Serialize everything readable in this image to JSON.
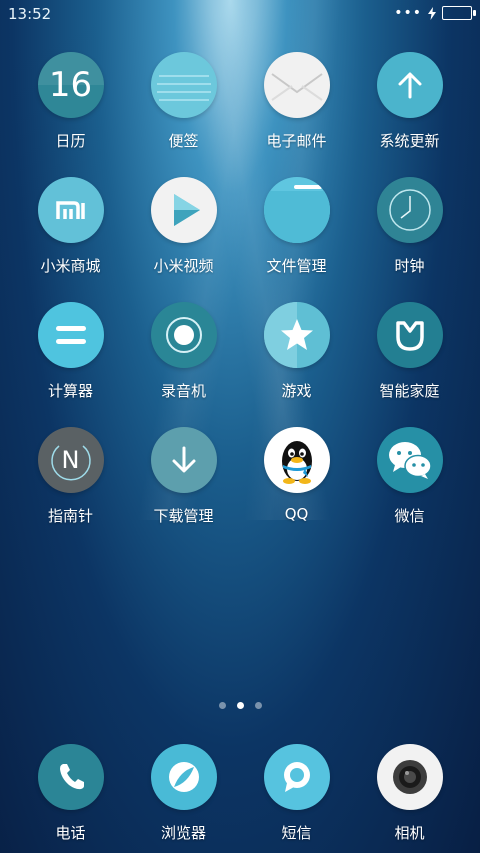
{
  "status": {
    "time": "13:52"
  },
  "colors": {
    "teal_dark": "#2e8796",
    "teal_light": "#62c4d6",
    "cyan": "#4cc0dc",
    "gray_dark": "#5c6467",
    "white": "#f2f2f2"
  },
  "apps": [
    {
      "label": "日历",
      "icon": "calendar-icon",
      "icon_text": "16"
    },
    {
      "label": "便签",
      "icon": "notes-icon"
    },
    {
      "label": "电子邮件",
      "icon": "mail-icon"
    },
    {
      "label": "系统更新",
      "icon": "update-arrow-icon"
    },
    {
      "label": "小米商城",
      "icon": "mi-store-icon",
      "icon_text": "mi"
    },
    {
      "label": "小米视频",
      "icon": "video-play-icon"
    },
    {
      "label": "文件管理",
      "icon": "folder-icon"
    },
    {
      "label": "时钟",
      "icon": "clock-icon"
    },
    {
      "label": "计算器",
      "icon": "calculator-icon"
    },
    {
      "label": "录音机",
      "icon": "recorder-icon"
    },
    {
      "label": "游戏",
      "icon": "game-star-icon"
    },
    {
      "label": "智能家庭",
      "icon": "smart-home-icon"
    },
    {
      "label": "指南针",
      "icon": "compass-icon",
      "icon_text": "N"
    },
    {
      "label": "下载管理",
      "icon": "download-icon"
    },
    {
      "label": "QQ",
      "icon": "qq-penguin-icon"
    },
    {
      "label": "微信",
      "icon": "wechat-icon"
    }
  ],
  "page_indicator": {
    "count": 3,
    "active": 2
  },
  "dock": [
    {
      "label": "电话",
      "icon": "phone-icon"
    },
    {
      "label": "浏览器",
      "icon": "browser-icon"
    },
    {
      "label": "短信",
      "icon": "sms-icon"
    },
    {
      "label": "相机",
      "icon": "camera-icon"
    }
  ]
}
